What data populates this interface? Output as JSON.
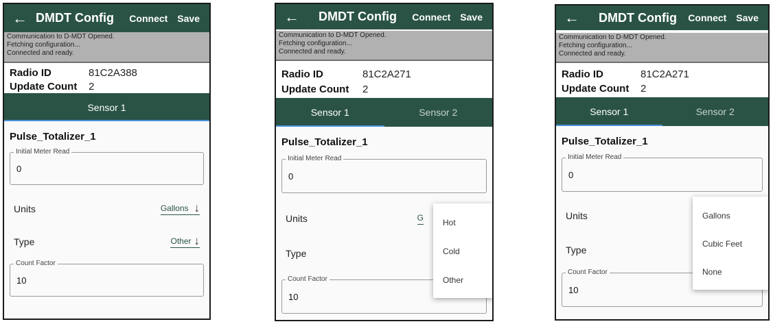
{
  "app": {
    "title": "DMDT Config",
    "connect_label": "Connect",
    "save_label": "Save",
    "back_glyph": "←"
  },
  "status_lines": [
    "Communication to D-MDT Opened.",
    "Fetching configuration...",
    "Connected and ready."
  ],
  "labels": {
    "radio_id": "Radio ID",
    "update_count": "Update Count",
    "initial_meter_read": "Initial Meter Read",
    "units": "Units",
    "type": "Type",
    "count_factor": "Count Factor"
  },
  "screens": [
    {
      "radio_id": "81C2A388",
      "update_count": "2",
      "tabs": [
        "Sensor 1"
      ],
      "sensor_name": "Pulse_Totalizer_1",
      "initial_meter_read": "0",
      "units_value": "Gallons",
      "type_value": "Other",
      "count_factor": "10"
    },
    {
      "radio_id": "81C2A271",
      "update_count": "2",
      "tabs": [
        "Sensor 1",
        "Sensor 2"
      ],
      "sensor_name": "Pulse_Totalizer_1",
      "initial_meter_read": "0",
      "units_value_partial": "G",
      "count_factor": "10",
      "menu_items": [
        "Hot",
        "Cold",
        "Other"
      ]
    },
    {
      "radio_id": "81C2A271",
      "update_count": "2",
      "tabs": [
        "Sensor 1",
        "Sensor 2"
      ],
      "sensor_name": "Pulse_Totalizer_1",
      "initial_meter_read": "0",
      "count_factor": "10",
      "menu_items": [
        "Gallons",
        "Cubic Feet",
        "None"
      ]
    }
  ],
  "icons": {
    "back": "arrow-left-icon",
    "dropdown": "arrow-down-icon"
  },
  "colors": {
    "header": "#2a5346",
    "status_bg": "#b1b1b1",
    "tab_indicator": "#4a90d9"
  }
}
